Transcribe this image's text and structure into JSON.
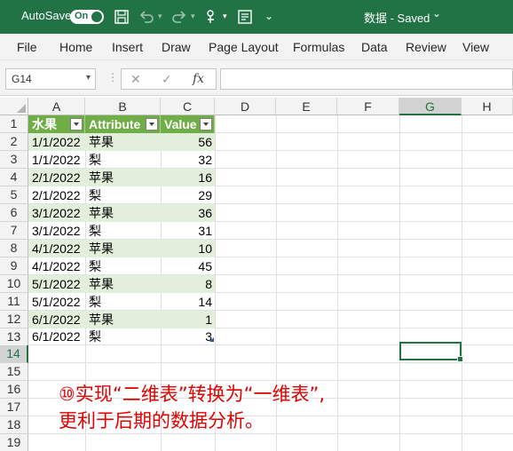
{
  "titlebar": {
    "autosave_label": "AutoSave",
    "autosave_state": "On",
    "doc_title": "数据 - Saved",
    "title_dropdown": "⌄"
  },
  "ribbon": {
    "tabs": [
      "File",
      "Home",
      "Insert",
      "Draw",
      "Page Layout",
      "Formulas",
      "Data",
      "Review",
      "View"
    ]
  },
  "formula_bar": {
    "name_box": "G14",
    "fx": "fx",
    "formula": ""
  },
  "grid": {
    "columns": [
      "A",
      "B",
      "C",
      "D",
      "E",
      "F",
      "G",
      "H"
    ],
    "selected_column": "G",
    "rows": [
      "1",
      "2",
      "3",
      "4",
      "5",
      "6",
      "7",
      "8",
      "9",
      "10",
      "11",
      "12",
      "13",
      "14",
      "15",
      "16",
      "17",
      "18",
      "19"
    ],
    "selected_row": "14"
  },
  "table": {
    "headers": [
      "水果",
      "Attribute",
      "Value"
    ],
    "rows": [
      [
        "1/1/2022",
        "苹果",
        "56"
      ],
      [
        "1/1/2022",
        "梨",
        "32"
      ],
      [
        "2/1/2022",
        "苹果",
        "16"
      ],
      [
        "2/1/2022",
        "梨",
        "29"
      ],
      [
        "3/1/2022",
        "苹果",
        "36"
      ],
      [
        "3/1/2022",
        "梨",
        "31"
      ],
      [
        "4/1/2022",
        "苹果",
        "10"
      ],
      [
        "4/1/2022",
        "梨",
        "45"
      ],
      [
        "5/1/2022",
        "苹果",
        "8"
      ],
      [
        "5/1/2022",
        "梨",
        "14"
      ],
      [
        "6/1/2022",
        "苹果",
        "1"
      ],
      [
        "6/1/2022",
        "梨",
        "3"
      ]
    ]
  },
  "annotation": {
    "line1": "⑩实现“二维表”转换为“一维表”,",
    "line2": "更利于后期的数据分析。"
  },
  "colors": {
    "excel_green": "#217346",
    "table_header": "#70ad47",
    "band": "#e2efda",
    "note": "#e00000"
  }
}
